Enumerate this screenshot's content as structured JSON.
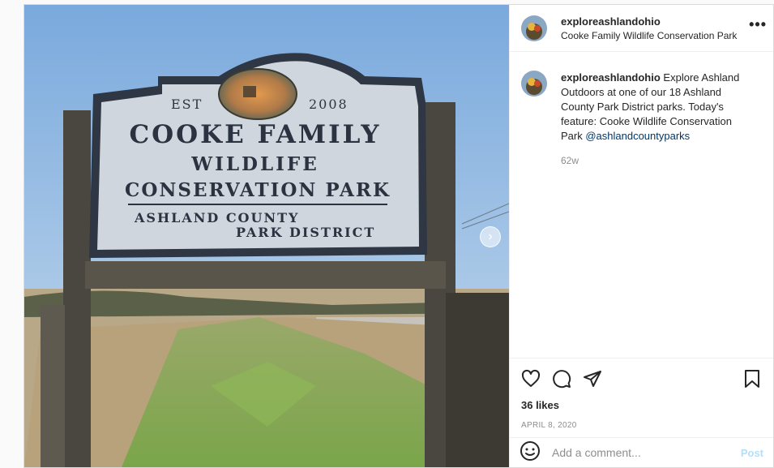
{
  "post": {
    "username": "exploreashlandohio",
    "location": "Cooke Family Wildlife Conservation Park",
    "caption_username": "exploreashlandohio",
    "caption_text": " Explore Ashland Outdoors at one of our 18 Ashland County Park District parks. Today's feature: Cooke Wildlife Conservation Park ",
    "caption_mention": "@ashlandcountyparks",
    "time_ago": "62w",
    "likes": "36 likes",
    "date": "APRIL 8, 2020",
    "more_icon": "•••",
    "next_icon": "›"
  },
  "sign": {
    "est": "EST",
    "year": "2008",
    "line1": "COOKE FAMILY",
    "line2": "WILDLIFE",
    "line3": "CONSERVATION PARK",
    "line4": "ASHLAND COUNTY",
    "line5": "PARK DISTRICT"
  },
  "comment_box": {
    "placeholder": "Add a comment...",
    "post_label": "Post"
  },
  "icons": {
    "like": "heart-icon",
    "comment": "comment-icon",
    "share": "share-icon",
    "save": "bookmark-icon",
    "emoji": "emoji-icon",
    "more": "more-options-icon",
    "next": "chevron-right-icon"
  },
  "colors": {
    "link": "#00376b",
    "muted": "#8e8e8e",
    "post_button": "#b2dffc",
    "sign_text": "#2c3340",
    "sign_face": "#cfd6de"
  }
}
